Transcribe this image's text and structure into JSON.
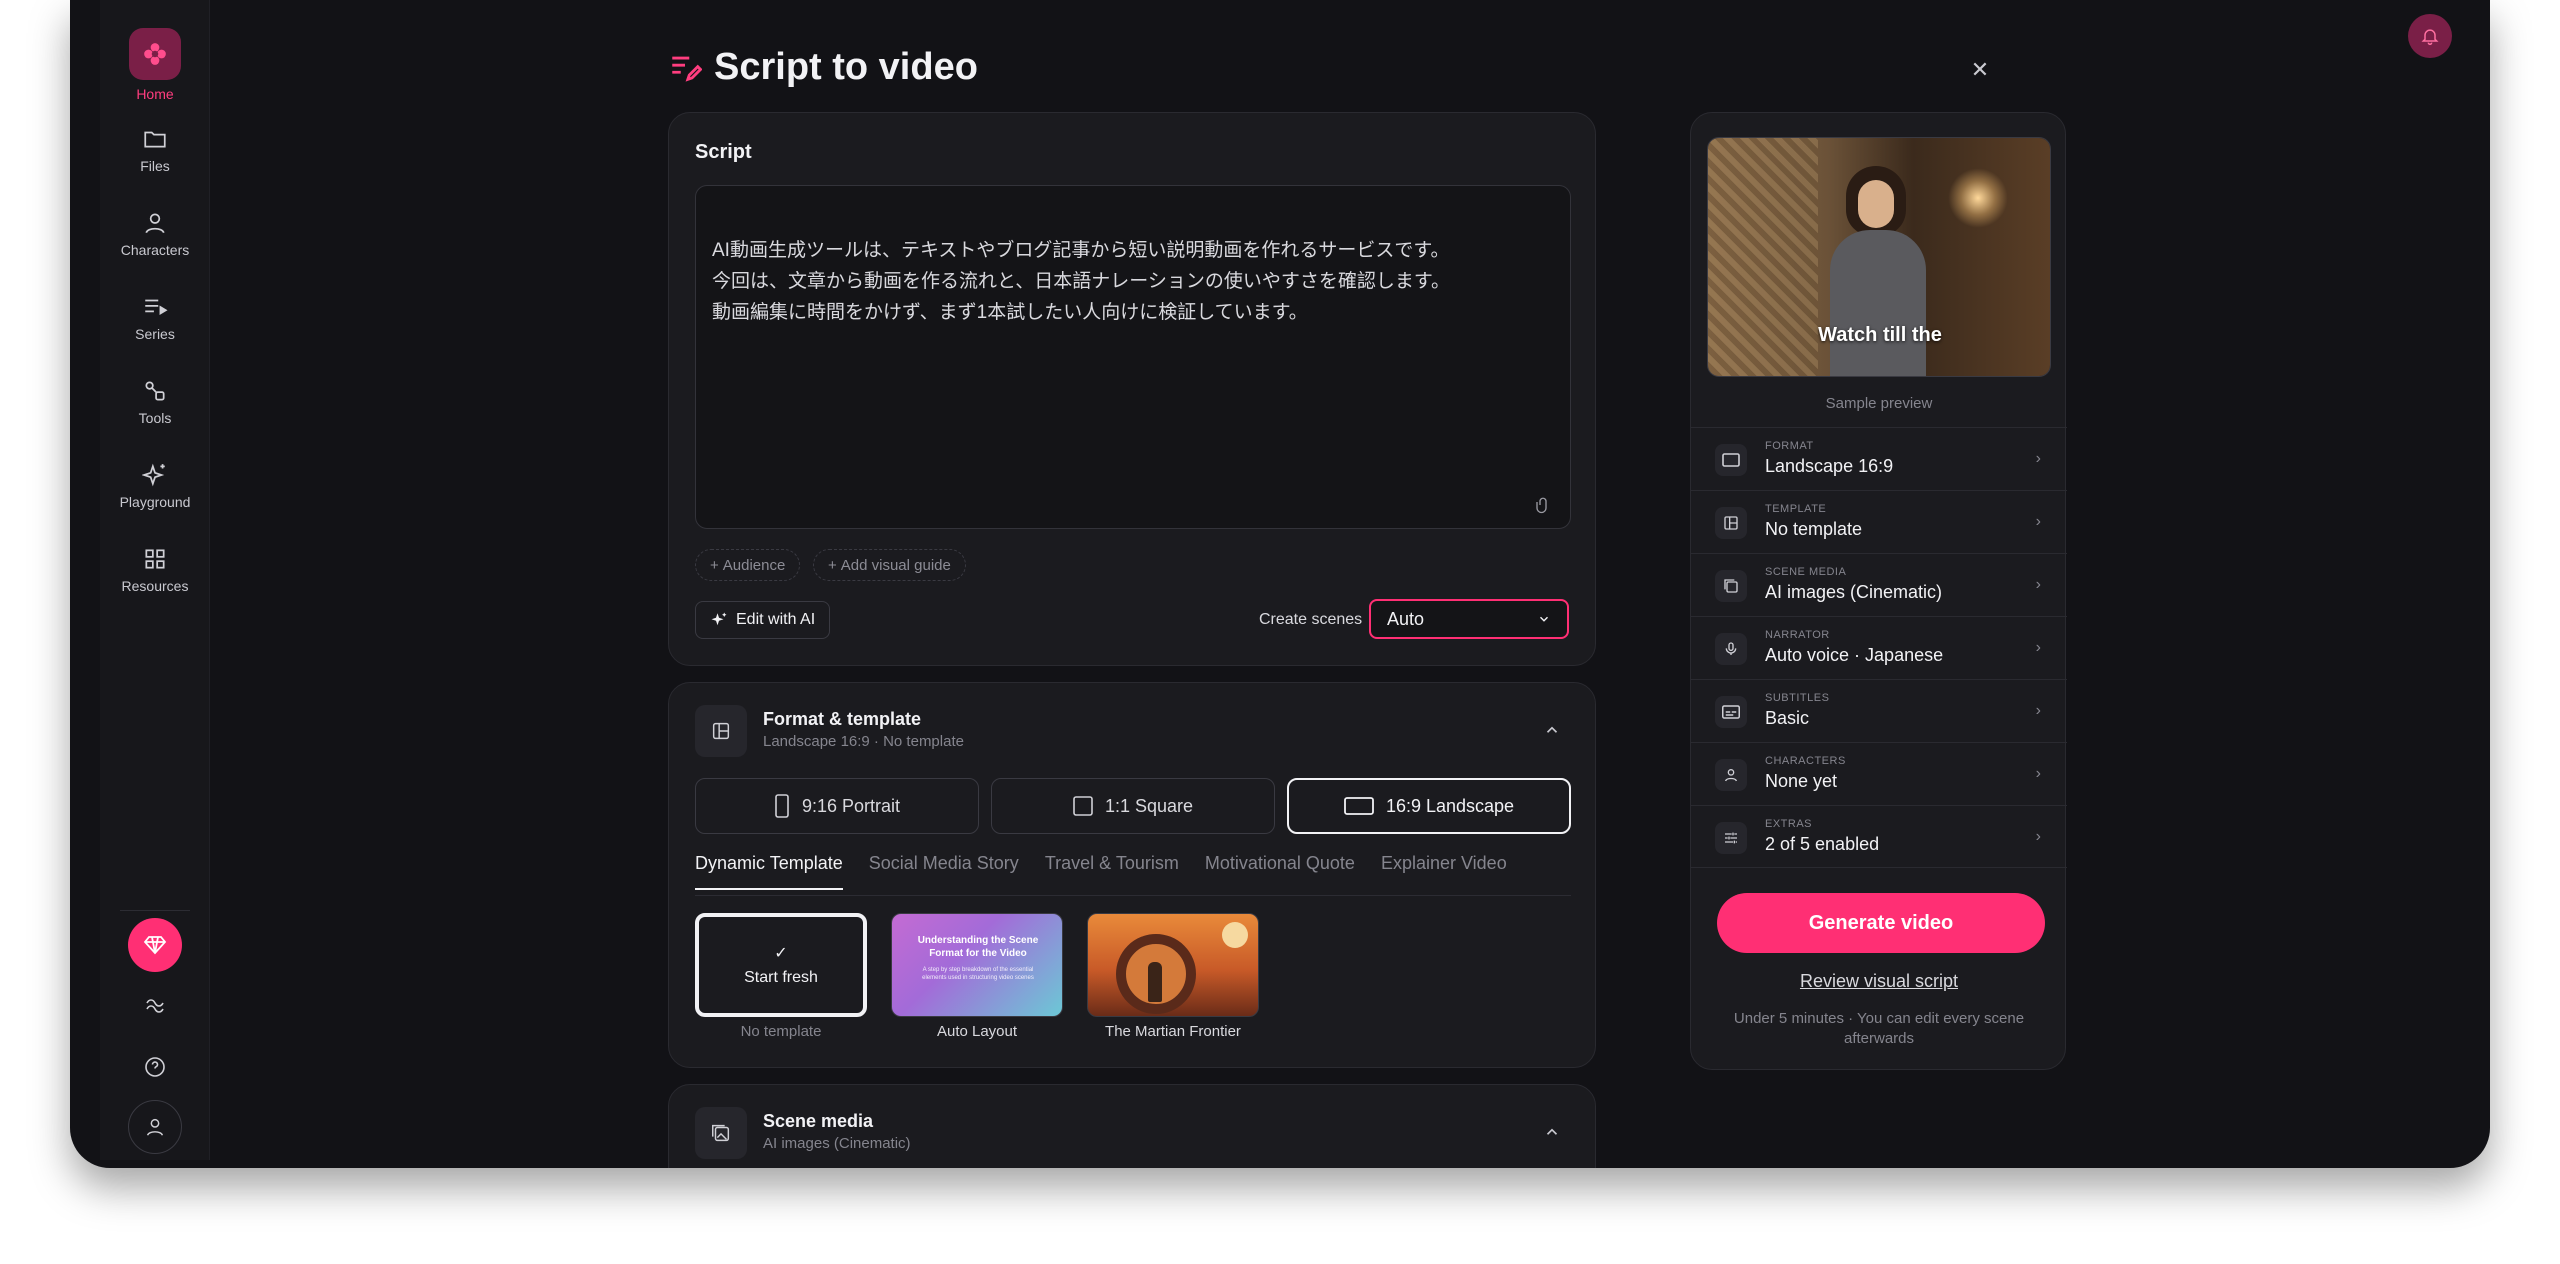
{
  "sidebar": {
    "items": [
      {
        "label": "Home",
        "icon": "flower-icon"
      },
      {
        "label": "Files",
        "icon": "folder-icon"
      },
      {
        "label": "Characters",
        "icon": "person-icon"
      },
      {
        "label": "Series",
        "icon": "series-icon"
      },
      {
        "label": "Tools",
        "icon": "tools-icon"
      },
      {
        "label": "Playground",
        "icon": "sparkle-icon"
      },
      {
        "label": "Resources",
        "icon": "grid-icon"
      }
    ]
  },
  "header": {
    "title": "Script to video"
  },
  "script": {
    "title": "Script",
    "text": "AI動画生成ツールは、テキストやブログ記事から短い説明動画を作れるサービスです。\n今回は、文章から動画を作る流れと、日本語ナレーションの使いやすさを確認します。\n動画編集に時間をかけず、まず1本試したい人向けに検証しています。",
    "chips": [
      "Audience",
      "Add visual guide"
    ],
    "edit_ai_label": "Edit with AI",
    "create_scenes_label": "Create scenes",
    "create_scenes_value": "Auto"
  },
  "format_section": {
    "title": "Format & template",
    "subtitle": "Landscape 16:9 · No template",
    "formats": [
      {
        "label": "9:16 Portrait",
        "selected": false
      },
      {
        "label": "1:1 Square",
        "selected": false
      },
      {
        "label": "16:9 Landscape",
        "selected": true
      }
    ],
    "tabs": [
      "Dynamic Template",
      "Social Media Story",
      "Travel & Tourism",
      "Motivational Quote",
      "Explainer Video"
    ],
    "templates": [
      {
        "inner": "Start fresh",
        "caption": "No template"
      },
      {
        "inner_title": "Understanding the Scene Format for the Video",
        "inner_sub": "A step by step breakdown of the essential elements used in structuring video scenes",
        "caption": "Auto Layout"
      },
      {
        "inner": "",
        "caption": "The Martian Frontier"
      }
    ]
  },
  "media_section": {
    "title": "Scene media",
    "subtitle": "AI images (Cinematic)"
  },
  "preview": {
    "overlay_text": "Watch till the",
    "caption": "Sample preview",
    "settings": [
      {
        "key": "FORMAT",
        "value": "Landscape 16:9",
        "icon": "rectangle-icon"
      },
      {
        "key": "TEMPLATE",
        "value": "No template",
        "icon": "layout-icon"
      },
      {
        "key": "SCENE MEDIA",
        "value": "AI images (Cinematic)",
        "icon": "images-icon"
      },
      {
        "key": "NARRATOR",
        "value": "Auto voice · Japanese",
        "icon": "microphone-icon"
      },
      {
        "key": "SUBTITLES",
        "value": "Basic",
        "icon": "subtitles-icon"
      },
      {
        "key": "CHARACTERS",
        "value": "None yet",
        "icon": "person-icon"
      },
      {
        "key": "EXTRAS",
        "value": "2 of 5 enabled",
        "icon": "sliders-icon"
      }
    ],
    "generate_label": "Generate video",
    "review_label": "Review visual script",
    "note": "Under 5 minutes · You can edit every scene afterwards"
  },
  "colors": {
    "accent": "#ff2f74",
    "bg": "#121216",
    "card": "#1b1b1f"
  }
}
